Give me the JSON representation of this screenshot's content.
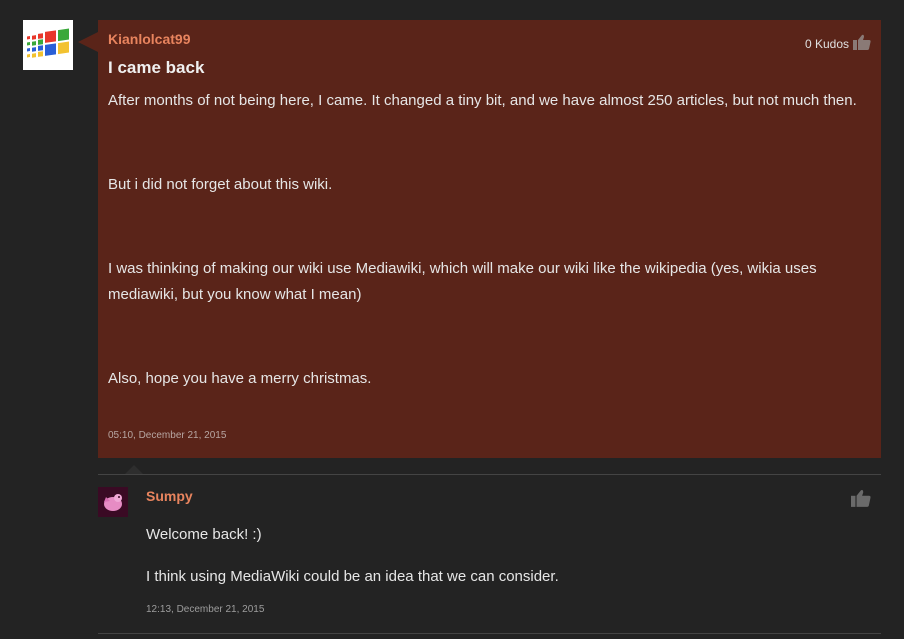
{
  "post": {
    "author": "Kianlolcat99",
    "kudos": "0 Kudos",
    "title": "I came back",
    "paragraphs": [
      "After months of not being here, I came. It changed a tiny bit, and we have almost 250 articles, but not much then.",
      "But i did not forget about this wiki.",
      "I was thinking of making our wiki use Mediawiki, which will make our wiki like the wikipedia (yes, wikia uses mediawiki, but you know what I mean)",
      "Also, hope you have a merry christmas."
    ],
    "timestamp": "05:10, December 21, 2015"
  },
  "reply": {
    "author": "Sumpy",
    "paragraphs": [
      "Welcome back! :)",
      "I think using MediaWiki could be an idea that we can consider."
    ],
    "timestamp": "12:13, December 21, 2015"
  },
  "icons": {
    "avatar_main": "windows-logo-icon",
    "like": "thumbs-up-icon",
    "avatar_reply": "pink-creature-icon"
  },
  "colors": {
    "background": "#232323",
    "post_bg": "#5a2419",
    "author": "#e8845e"
  }
}
